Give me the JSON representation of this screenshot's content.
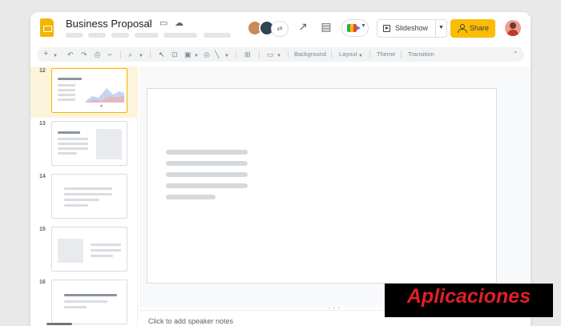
{
  "header": {
    "title": "Business Proposal",
    "slideshow_label": "Slideshow",
    "share_label": "Share"
  },
  "toolbar": {
    "background_label": "Background",
    "layout_label": "Layout",
    "theme_label": "Theme",
    "transition_label": "Transition"
  },
  "filmstrip": {
    "slides": [
      {
        "number": "12",
        "selected": true
      },
      {
        "number": "13",
        "selected": false
      },
      {
        "number": "14",
        "selected": false
      },
      {
        "number": "15",
        "selected": false
      },
      {
        "number": "16",
        "selected": false
      }
    ]
  },
  "notes": {
    "placeholder": "Click to add speaker notes"
  },
  "watermark": {
    "text": "Aplicaciones"
  },
  "colors": {
    "accent": "#fbbc04",
    "selected_slide_bg": "#fdf4dc",
    "watermark_text": "#e01f26"
  }
}
